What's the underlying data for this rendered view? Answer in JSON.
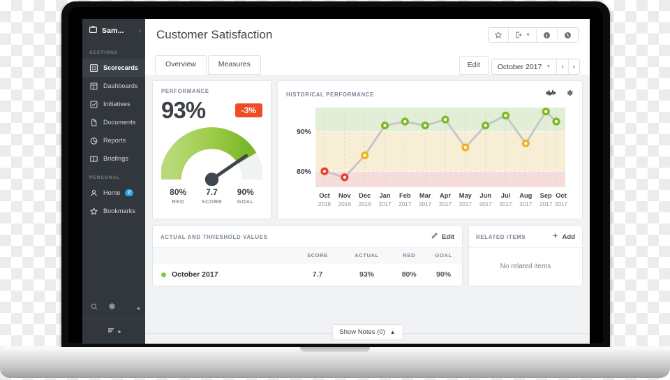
{
  "sidebar": {
    "workspace": "Sam...",
    "collapse_icon": "chevron-left-icon",
    "sections_label": "SECTIONS",
    "personal_label": "PERSONAL",
    "sections": [
      {
        "label": "Scorecards",
        "icon": "scorecard-grid-icon",
        "active": true
      },
      {
        "label": "Dashboards",
        "icon": "dashboard-icon",
        "active": false
      },
      {
        "label": "Initiatives",
        "icon": "checkbox-icon",
        "active": false
      },
      {
        "label": "Documents",
        "icon": "document-icon",
        "active": false
      },
      {
        "label": "Reports",
        "icon": "pie-chart-icon",
        "active": false
      },
      {
        "label": "Briefings",
        "icon": "book-icon",
        "active": false
      }
    ],
    "personal": [
      {
        "label": "Home",
        "icon": "person-icon",
        "badge": "2"
      },
      {
        "label": "Bookmarks",
        "icon": "star-icon",
        "badge": ""
      }
    ],
    "tools": [
      {
        "name": "search-icon"
      },
      {
        "name": "gear-icon"
      },
      {
        "name": "collapse-arrow-icon"
      }
    ],
    "footer_icon": "menu-list-icon"
  },
  "header": {
    "title": "Customer Satisfaction",
    "actions": [
      {
        "name": "favorite-star-icon"
      },
      {
        "name": "export-icon"
      },
      {
        "name": "info-icon"
      },
      {
        "name": "history-clock-icon"
      }
    ]
  },
  "tabs": [
    {
      "label": "Overview",
      "active": true
    },
    {
      "label": "Measures",
      "active": false
    }
  ],
  "toolbar": {
    "edit_label": "Edit",
    "period": "October 2017",
    "prev_icon": "chevron-left-icon",
    "next_icon": "chevron-right-icon",
    "dropdown_icon": "caret-down-icon"
  },
  "performance": {
    "title": "PERFORMANCE",
    "value": "93%",
    "delta": "-3%",
    "delta_color": "#f04b27",
    "red_value": "80%",
    "red_label": "RED",
    "score_value": "7.7",
    "score_label": "SCORE",
    "goal_value": "90%",
    "goal_label": "GOAL",
    "gauge_percent": 93,
    "gauge_needle_deg": 62
  },
  "history": {
    "title": "HISTORICAL PERFORMANCE",
    "chart_icon": "sparkline-icon",
    "settings_icon": "gear-icon"
  },
  "chart_data": {
    "type": "line",
    "title": "HISTORICAL PERFORMANCE",
    "xlabel": "",
    "ylabel": "",
    "ylim": [
      76,
      96
    ],
    "ytick_values": [
      80,
      90
    ],
    "ytick_labels": [
      "80%",
      "90%"
    ],
    "grid": true,
    "legend": false,
    "categories": [
      "Oct",
      "Nov",
      "Dec",
      "Jan",
      "Feb",
      "Mar",
      "Apr",
      "May",
      "Jun",
      "Jul",
      "Aug",
      "Sep",
      "Oct"
    ],
    "category_years": [
      "2016",
      "2016",
      "2016",
      "2017",
      "2017",
      "2017",
      "2017",
      "2017",
      "2017",
      "2017",
      "2017",
      "2017",
      "2017"
    ],
    "values": [
      80,
      78.5,
      84,
      91.5,
      92.5,
      91.5,
      93,
      86,
      91.5,
      94,
      87,
      95,
      92.5
    ],
    "point_colors": [
      "#e8402a",
      "#e8402a",
      "#f0b323",
      "#7fb927",
      "#7fb927",
      "#7fb927",
      "#7fb927",
      "#f0b323",
      "#7fb927",
      "#7fb927",
      "#f0b323",
      "#7fb927",
      "#7fb927"
    ],
    "bands": [
      {
        "name": "green",
        "from": 90,
        "to": 96,
        "color": "#e2eed6"
      },
      {
        "name": "yellow",
        "from": 80,
        "to": 90,
        "color": "#f8eed6"
      },
      {
        "name": "red",
        "from": 76,
        "to": 80,
        "color": "#f7dcdc"
      }
    ],
    "line_color": "#c3c7ca"
  },
  "actual_threshold": {
    "title": "ACTUAL AND THRESHOLD VALUES",
    "edit_label": "Edit",
    "edit_icon": "pencil-icon",
    "columns": [
      "",
      "SCORE",
      "ACTUAL",
      "RED",
      "GOAL"
    ],
    "rows": [
      {
        "name": "October 2017",
        "score": "7.7",
        "actual": "93%",
        "red": "80%",
        "goal": "90%",
        "status_color": "#8bc53f"
      }
    ]
  },
  "related_items": {
    "title": "RELATED ITEMS",
    "add_label": "Add",
    "add_icon": "plus-icon",
    "empty_text": "No related items"
  },
  "notes": {
    "label": "Show Notes (0)",
    "icon": "chevron-up-icon"
  }
}
